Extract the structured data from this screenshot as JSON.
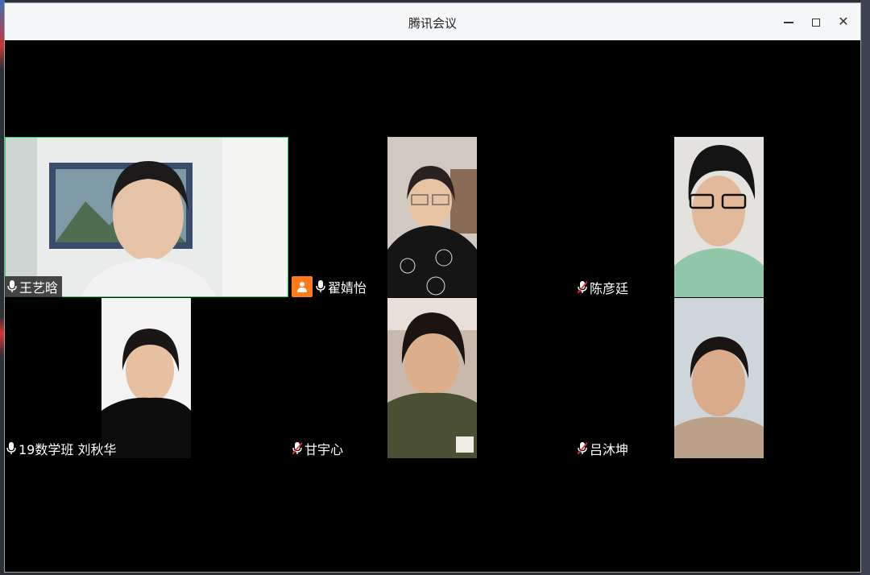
{
  "window": {
    "title": "腾讯会议"
  },
  "participants": [
    {
      "name": "王艺晗",
      "mic": "on"
    },
    {
      "name": "翟婧怡",
      "mic": "on",
      "host": true
    },
    {
      "name": "陈彦廷",
      "mic": "muted"
    },
    {
      "name": "19数学班 刘秋华",
      "mic": "on"
    },
    {
      "name": "甘宇心",
      "mic": "muted"
    },
    {
      "name": "吕沐坤",
      "mic": "muted"
    }
  ],
  "colors": {
    "active_speaker_border": "#2bd46a",
    "host_badge": "#ff7a1a",
    "muted_icon": "#e03030"
  }
}
